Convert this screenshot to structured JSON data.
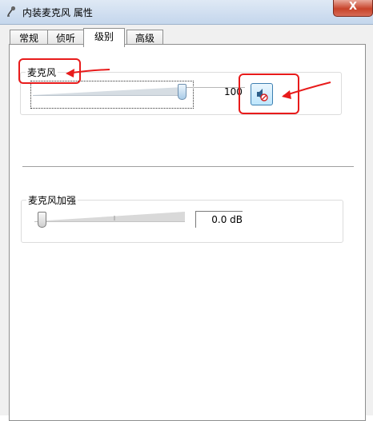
{
  "window": {
    "title": "内装麦克风 属性",
    "close_label": "X"
  },
  "tabs": [
    {
      "label": "常规",
      "active": false
    },
    {
      "label": "侦听",
      "active": false
    },
    {
      "label": "级别",
      "active": true
    },
    {
      "label": "高级",
      "active": false
    }
  ],
  "microphone": {
    "label": "麦克风",
    "level": 100,
    "level_text": "100",
    "mute_icon": "speaker-muted-icon"
  },
  "boost": {
    "label": "麦克风加强",
    "value_text": "0.0 dB"
  },
  "colors": {
    "annotation": "#e81b1b",
    "accent": "#3c7fb1"
  }
}
